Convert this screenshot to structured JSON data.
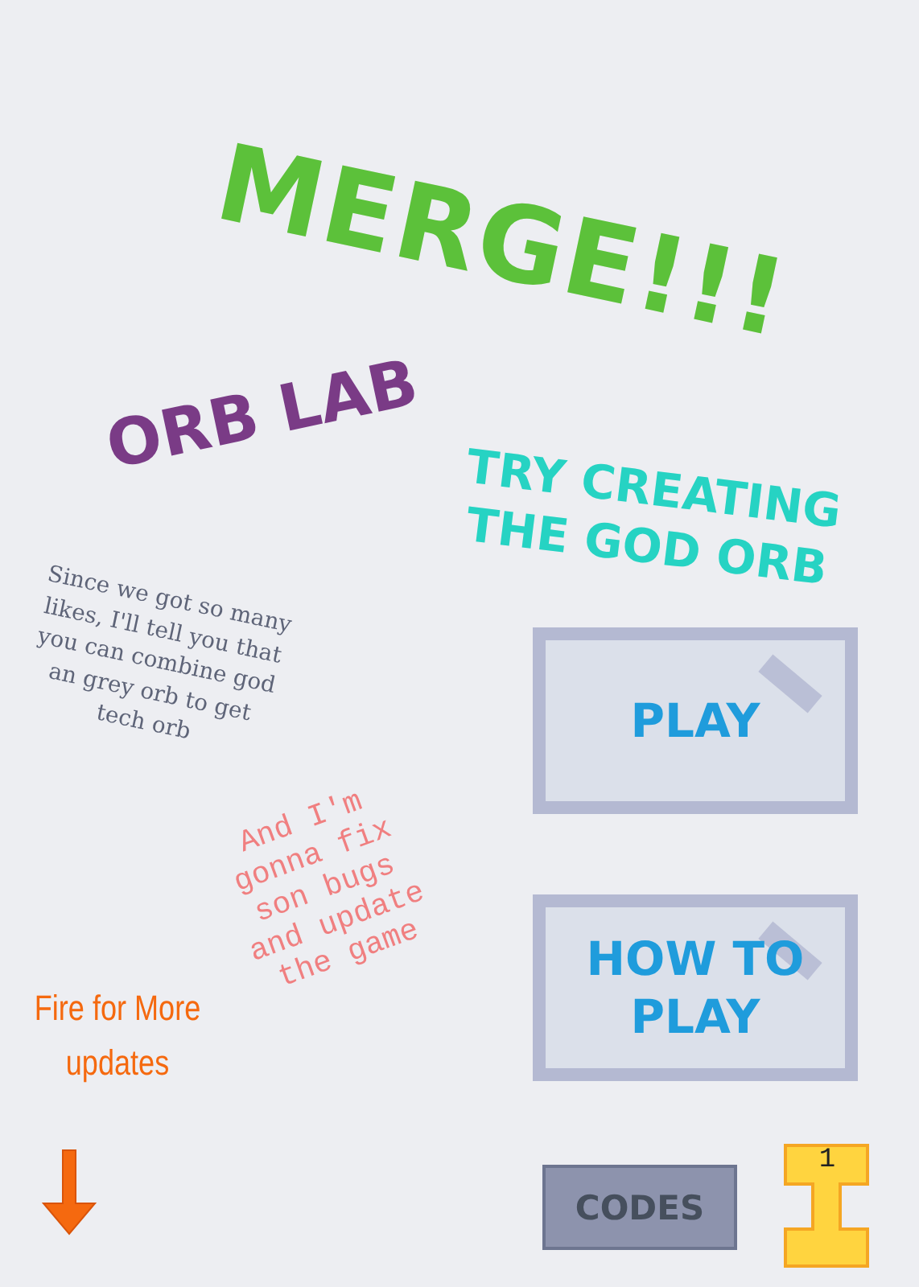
{
  "title": "MERGE!!!",
  "subtitle": "ORB LAB",
  "tagline": "TRY CREATING\nTHE GOD ORB",
  "note": "Since we got so many\nlikes, I'll tell you that\nyou can combine god\nan grey orb to get\ntech orb",
  "promise": "And I'm\ngonna fix\nson bugs\nand update\nthe game",
  "fire_note": "Fire for More\nupdates",
  "buttons": [
    {
      "label": "PLAY"
    },
    {
      "label": "HOW TO\nPLAY"
    }
  ],
  "codes_button": "CODES",
  "counter": "1"
}
